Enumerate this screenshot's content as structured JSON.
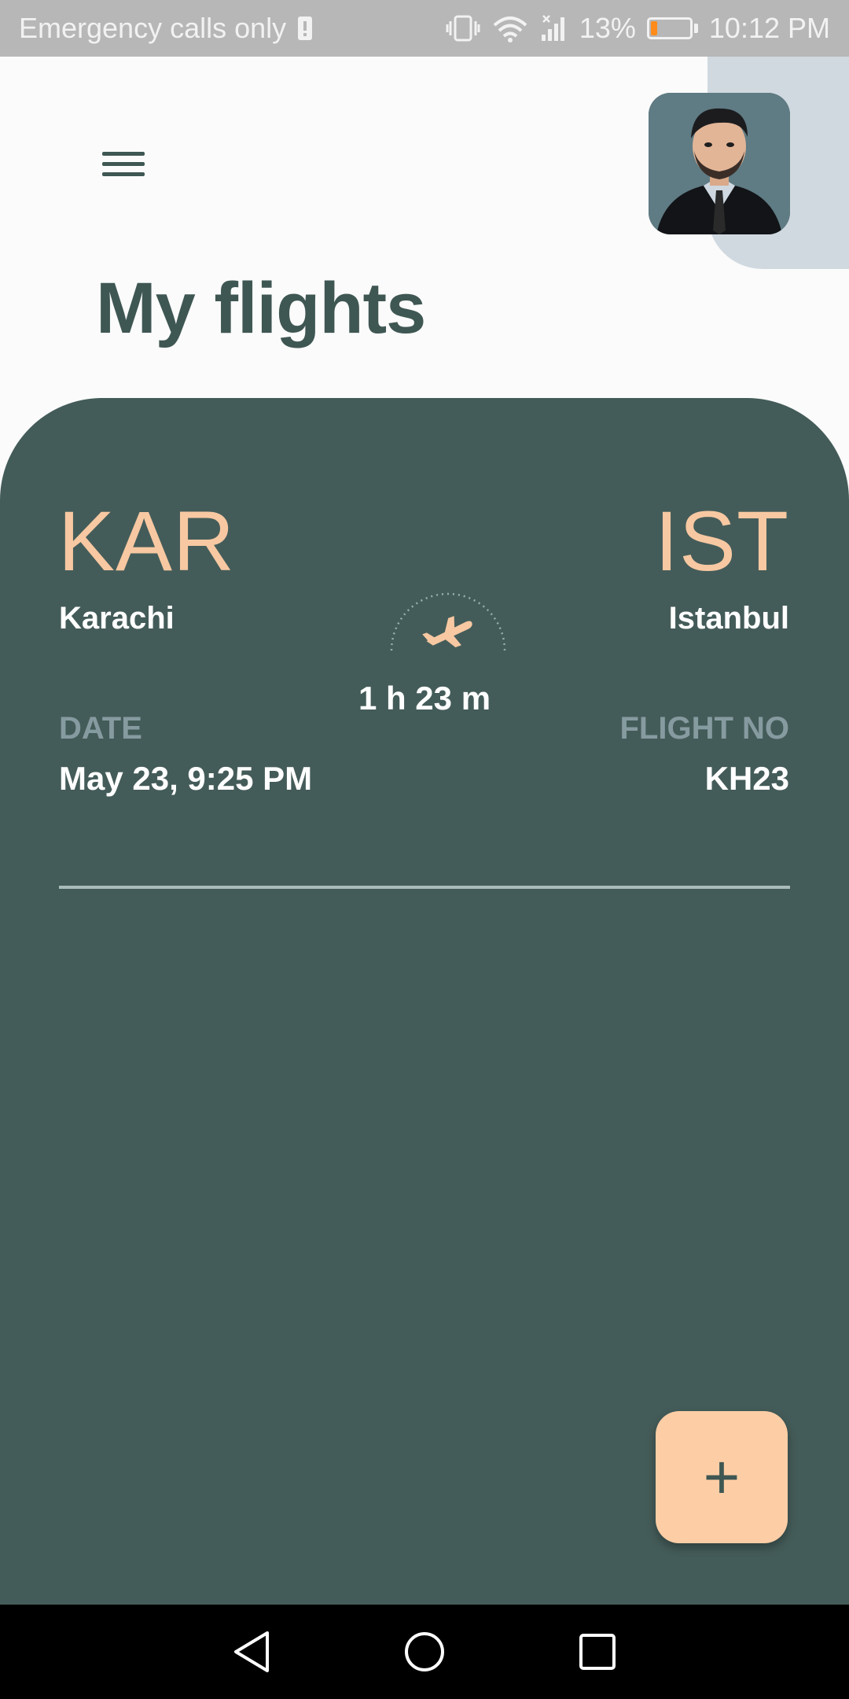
{
  "status_bar": {
    "carrier_text": "Emergency calls only",
    "battery_percent": "13%",
    "time": "10:12 PM",
    "icons": [
      "sim-alert-icon",
      "vibrate-icon",
      "wifi-icon",
      "signal-icon",
      "battery-icon"
    ]
  },
  "header": {
    "menu_icon": "menu-icon",
    "title": "My flights",
    "avatar_alt": "profile-photo"
  },
  "flight": {
    "from_code": "KAR",
    "from_city": "Karachi",
    "to_code": "IST",
    "to_city": "Istanbul",
    "duration": "1 h 23 m",
    "date_label": "DATE",
    "date_value": "May 23, 9:25 PM",
    "flight_no_label": "FLIGHT NO",
    "flight_no_value": "KH23",
    "plane_icon": "airplane-icon"
  },
  "fab": {
    "label": "+",
    "icon": "plus-icon"
  },
  "nav_bar": {
    "icons": [
      "back-icon",
      "home-icon",
      "recents-icon"
    ]
  },
  "colors": {
    "card_bg": "#445c59",
    "accent": "#f7c8a2",
    "title": "#3f5753",
    "fab_bg": "#fdcea6"
  }
}
